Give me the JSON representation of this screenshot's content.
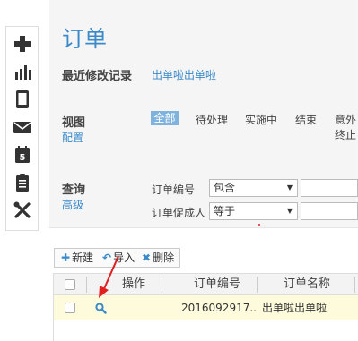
{
  "page": {
    "title": "订单"
  },
  "recent": {
    "label": "最近修改记录",
    "link": "出单啦出单啦"
  },
  "view": {
    "label": "视图",
    "config_link": "配置",
    "segments": [
      "全部",
      "待处理",
      "实施中",
      "结束",
      "意外终止"
    ],
    "active_segment": "全部"
  },
  "query": {
    "label": "查询",
    "advanced_link": "高级",
    "fields": [
      {
        "label": "订单编号",
        "operator": "包含"
      },
      {
        "label": "订单促成人",
        "operator": "等于"
      }
    ]
  },
  "toolbar": {
    "new": "新建",
    "import": "导入",
    "delete": "删除"
  },
  "grid": {
    "columns": [
      "操作",
      "订单编号",
      "订单名称"
    ],
    "rows": [
      {
        "order_no": "2016092917...",
        "order_name": "出单啦出单啦"
      }
    ]
  },
  "colors": {
    "accent": "#3a89c9",
    "row_highlight": "#fdfbdc",
    "arrow": "#e02020"
  }
}
